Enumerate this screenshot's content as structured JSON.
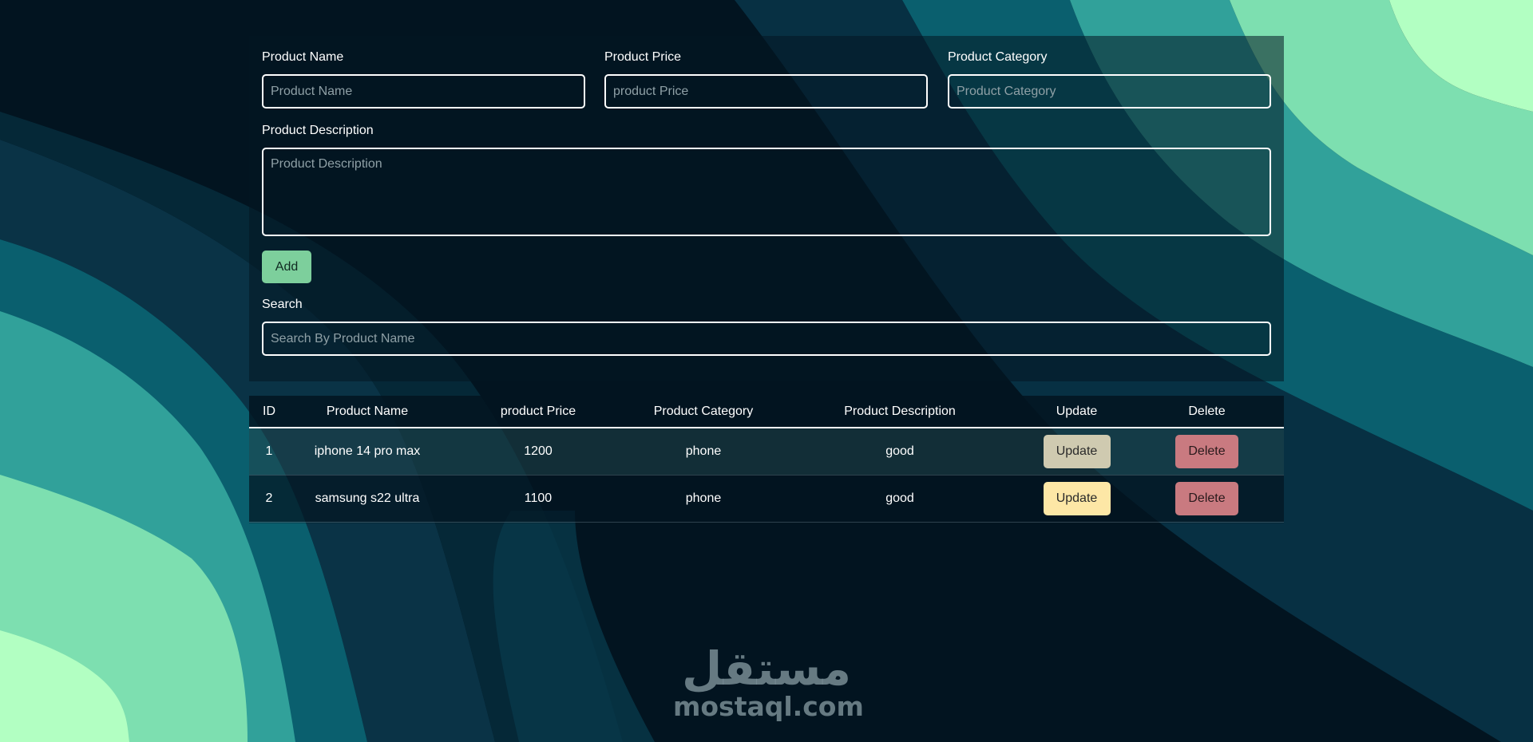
{
  "form": {
    "name_label": "Product Name",
    "name_placeholder": "Product Name",
    "price_label": "Product Price",
    "price_placeholder": "product Price",
    "category_label": "Product Category",
    "category_placeholder": "Product Category",
    "description_label": "Product Description",
    "description_placeholder": "Product Description",
    "add_label": "Add",
    "search_label": "Search",
    "search_placeholder": "Search By Product Name"
  },
  "table": {
    "headers": [
      "ID",
      "Product Name",
      "product Price",
      "Product Category",
      "Product Description",
      "Update",
      "Delete"
    ],
    "rows": [
      {
        "id": "1",
        "name": "iphone 14 pro max",
        "price": "1200",
        "category": "phone",
        "description": "good",
        "update": "Update",
        "delete": "Delete"
      },
      {
        "id": "2",
        "name": "samsung s22 ultra",
        "price": "1100",
        "category": "phone",
        "description": "good",
        "update": "Update",
        "delete": "Delete"
      }
    ]
  },
  "watermark": {
    "arabic": "مستقل",
    "latin": "mostaql.com"
  },
  "colors": {
    "add_button": "#7dcf9c",
    "update_button_row1": "#cfcab0",
    "update_button_row2": "#fde7a6",
    "delete_button": "#c97a80",
    "background_dark": "#021420",
    "wave_teal": "#0a5f6e",
    "wave_mint": "#7ddfb0"
  }
}
